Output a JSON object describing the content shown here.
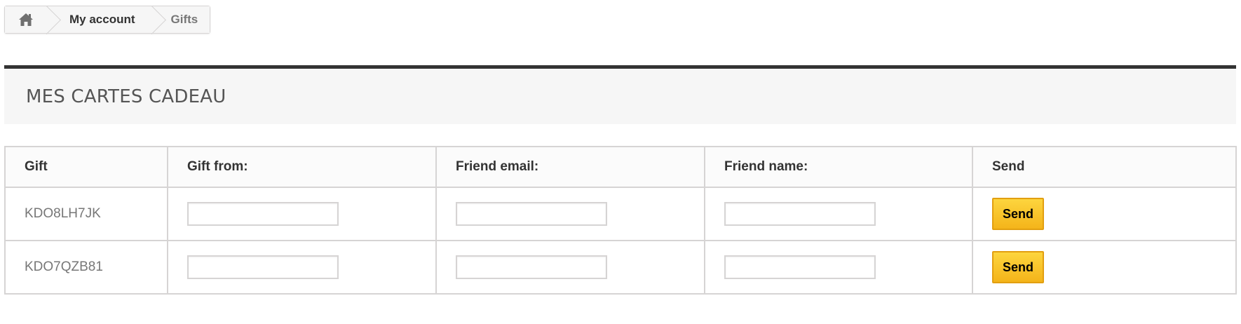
{
  "breadcrumb": {
    "home_icon": "home-icon",
    "account": "My account",
    "current": "Gifts"
  },
  "page": {
    "title": "MES CARTES CADEAU"
  },
  "table": {
    "headers": [
      "Gift",
      "Gift from:",
      "Friend email:",
      "Friend name:",
      "Send"
    ],
    "rows": [
      {
        "code": "KDO8LH7JK",
        "gift_from": "",
        "friend_email": "",
        "friend_name": "",
        "send_label": "Send"
      },
      {
        "code": "KDO7QZB81",
        "gift_from": "",
        "friend_email": "",
        "friend_name": "",
        "send_label": "Send"
      }
    ]
  },
  "colors": {
    "button": "#f4b41a",
    "heading_rule": "#333333",
    "border": "#d6d4d4"
  }
}
